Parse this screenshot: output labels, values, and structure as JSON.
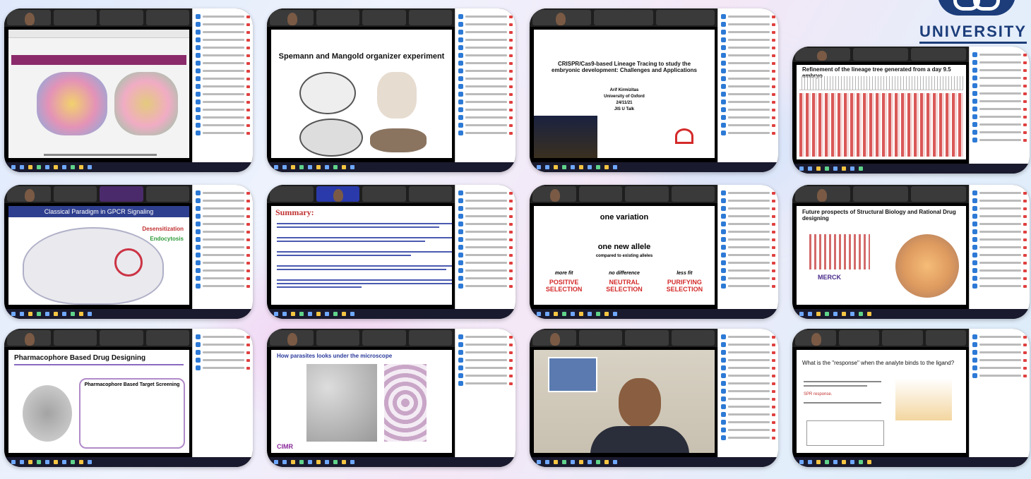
{
  "logo": {
    "text": "UNIVERSITY"
  },
  "tiles": [
    {
      "id": "t1",
      "title": ""
    },
    {
      "id": "t2",
      "title": "Spemann and Mangold organizer experiment"
    },
    {
      "id": "t3",
      "title": "CRISPR/Cas9-based Lineage Tracing to study the embryonic development: Challenges and Applications",
      "sub": [
        "Arif Kirmizitas",
        "University of Oxford",
        "24/11/21",
        "JIS U Talk"
      ]
    },
    {
      "id": "t4",
      "title": "Refinement of the lineage tree generated from a day 9.5 embryo"
    },
    {
      "id": "t5",
      "title": "Classical Paradigm in GPCR Signaling",
      "labels": [
        "Desensitization",
        "Endocytosis"
      ]
    },
    {
      "id": "t6",
      "title": "Summary:"
    },
    {
      "id": "t7",
      "lines": [
        "one variation",
        "one new allele",
        "compared to existing alleles"
      ],
      "cols": [
        {
          "h": "more fit",
          "a": "POSITIVE",
          "b": "SELECTION"
        },
        {
          "h": "no difference",
          "a": "NEUTRAL",
          "b": "SELECTION"
        },
        {
          "h": "less fit",
          "a": "PURIFYING",
          "b": "SELECTION"
        }
      ]
    },
    {
      "id": "t8",
      "title": "Future prospects of Structural Biology and Rational Drug designing",
      "brand": "MERCK"
    },
    {
      "id": "t9",
      "title": "Pharmacophore Based Drug Designing",
      "sub": "Pharmacophore Based Target Screening"
    },
    {
      "id": "t10",
      "title": "How parasites looks under the microscope",
      "brand": "CIMR"
    },
    {
      "id": "t11",
      "title": ""
    },
    {
      "id": "t12",
      "title": "What is the \"response\" when the analyte binds to the ligand?",
      "sub": "SPR response."
    }
  ]
}
